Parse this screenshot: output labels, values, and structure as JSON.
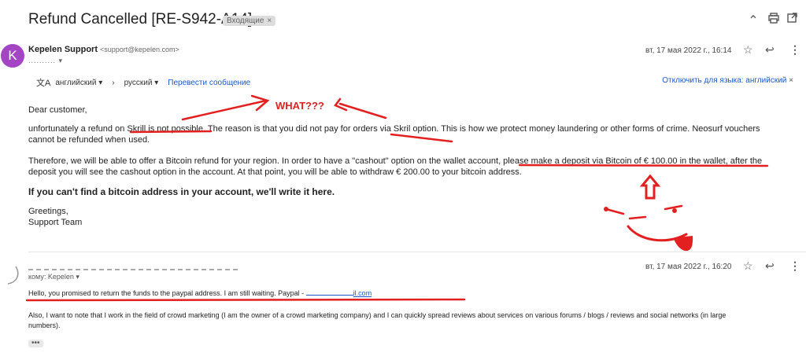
{
  "header": {
    "subject": "Refund Cancelled [RE-S942-A14]",
    "label": "Входящие",
    "label_close": "×",
    "icons": [
      "collapse-icon",
      "print-icon",
      "open-new-window-icon"
    ]
  },
  "message1": {
    "avatar_letter": "K",
    "sender_name": "Kepelen Support",
    "sender_email": "<support@kepelen.com>",
    "recipient_masked": "..........",
    "date": "вт, 17 мая 2022 г., 16:14",
    "translate": {
      "from_lang": "английский",
      "to_lang": "русский",
      "translate_link": "Перевести сообщение",
      "disable": "Отключить для языка: английский"
    },
    "greeting": "Dear customer,",
    "para1_a": "unfortunately a refund on Skrill is not possible. The reason is that you did not pay for orders via Skril option. This is how we protect money laundering or other forms of crime. Neosurf vouchers",
    "para1_b": "cannot be refunded when used.",
    "para2_a": "Therefore, we will be able to offer a Bitcoin refund for your region. In order to have a \"cashout\" option on the wallet account, please make a deposit via Bitcoin of € 100.00 in the wallet, after the",
    "para2_b": "deposit you will see the cashout option in the account. At that point, you will be able to withdraw € 200.00 to your bitcoin address.",
    "bold_line": "If you can't find a bitcoin address in your account, we'll write it here.",
    "signoff_1": "Greetings,",
    "signoff_2": "Support Team"
  },
  "annotation": {
    "text": "WHAT???",
    "color": "#e32020"
  },
  "message2": {
    "recipient": "кому: Kepelen",
    "date": "вт, 17 мая 2022 г., 16:20",
    "line1_a": "Hello, you promised to return the funds to the paypal address. I am still waiting. Paypal - ",
    "line1_link": "il.com",
    "line2_a": " Also, I want to note that I work in the field of crowd marketing (I am the owner of a crowd marketing company) and I can quickly spread reviews about services on various forums / blogs / reviews and social networks (in large",
    "line2_b": "numbers).",
    "ellipsis": "•••"
  }
}
